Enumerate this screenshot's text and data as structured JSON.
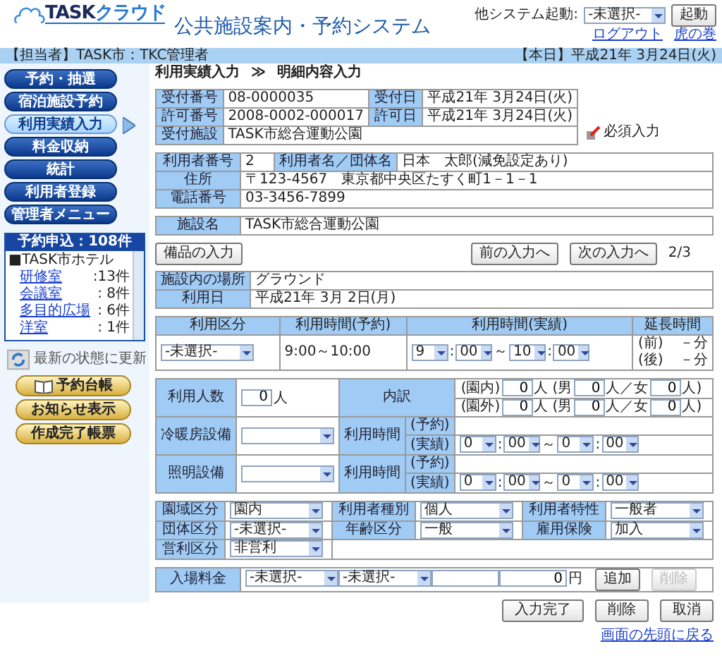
{
  "header": {
    "logo": {
      "brand": "TASK",
      "suffix": "クラウド"
    },
    "title": "公共施設案内・予約システム",
    "launcher_label": "他システム起動:",
    "launcher_select": "-未選択-",
    "launch_button": "起動",
    "links": [
      "ログアウト",
      "虎の巻"
    ]
  },
  "info_bar": {
    "user": "【担当者】TASK市：TKC管理者",
    "today": "【本日】平成21年 3月24日(火)"
  },
  "menu": [
    {
      "label": "予約・抽選",
      "selected": false
    },
    {
      "label": "宿泊施設予約",
      "selected": false
    },
    {
      "label": "利用実績入力",
      "selected": true
    },
    {
      "label": "料金収納",
      "selected": false
    },
    {
      "label": "統計",
      "selected": false
    },
    {
      "label": "利用者登録",
      "selected": false
    },
    {
      "label": "管理者メニュー",
      "selected": false
    }
  ],
  "requests": {
    "title": "予約申込：108件",
    "group": "■TASK市ホテル",
    "items": [
      {
        "name": "研修室",
        "count": ":13件"
      },
      {
        "name": "会議室",
        "count": ": 8件"
      },
      {
        "name": "多目的広場",
        "count": ": 6件"
      },
      {
        "name": "洋室",
        "count": ": 1件"
      }
    ]
  },
  "refresh_button": "最新の状態に更新",
  "side_buttons": [
    {
      "label": "予約台帳",
      "kind": "book"
    },
    {
      "label": "お知らせ表示",
      "kind": "plain"
    },
    {
      "label": "作成完了帳票",
      "kind": "plain"
    }
  ],
  "breadcrumb": {
    "parent": "利用実績入力",
    "separator": "≫",
    "current": "明細内容入力"
  },
  "receipt": [
    [
      {
        "label": "受付番号",
        "value": "08-0000035"
      },
      {
        "label": "受付日",
        "value": "平成21年 3月24日(火)"
      }
    ],
    [
      {
        "label": "許可番号",
        "value": "2008-0002-000017"
      },
      {
        "label": "許可日",
        "value": "平成21年 3月24日(火)"
      }
    ],
    [
      {
        "label": "受付施設",
        "value": "TASK市総合運動公園"
      }
    ]
  ],
  "required_note": "必須入力",
  "user_info": [
    [
      {
        "label": "利用者番号",
        "value": "2"
      },
      {
        "label": "利用者名／団体名",
        "value": "日本　太郎(減免設定あり)"
      }
    ],
    [
      {
        "label": "住所",
        "value": "〒123-4567　東京都中央区たすく町1－1－1"
      }
    ],
    [
      {
        "label": "電話番号",
        "value": "03-3456-7899"
      }
    ]
  ],
  "facility": [
    [
      {
        "label": "施設名",
        "value": "TASK市総合運動公園"
      }
    ]
  ],
  "nav": {
    "equipment_button": "備品の入力",
    "prev_button": "前の入力へ",
    "next_button": "次の入力へ",
    "page": "2/3"
  },
  "place": [
    [
      {
        "label": "施設内の場所",
        "value": "グラウンド"
      }
    ],
    [
      {
        "label": "利用日",
        "value": "平成21年 3月 2日(月)"
      }
    ]
  ],
  "usage": {
    "headers": [
      "利用区分",
      "利用時間(予約)",
      "利用時間(実績)",
      "延長時間"
    ],
    "category": "-未選択-",
    "reserved_time": "9:00～10:00",
    "actual_time": [
      {
        "kind": "time",
        "value": "9"
      },
      {
        "kind": "text",
        "text": ":"
      },
      {
        "kind": "time",
        "value": "00"
      },
      {
        "kind": "text",
        "text": "～"
      },
      {
        "kind": "time",
        "value": "10"
      },
      {
        "kind": "text",
        "text": ":"
      },
      {
        "kind": "time",
        "value": "00"
      }
    ],
    "extension": [
      {
        "label": "(前)",
        "value": "－分"
      },
      {
        "label": "(後)",
        "value": "－分"
      }
    ]
  },
  "attendance": {
    "label": "利用人数",
    "count": "0",
    "unit": "人",
    "breakdown_label": "内訳",
    "breakdown": [
      [
        {
          "kind": "text",
          "text": "(園内)"
        },
        {
          "kind": "input",
          "value": "0"
        },
        {
          "kind": "text",
          "text": "人 (男"
        },
        {
          "kind": "input",
          "value": "0"
        },
        {
          "kind": "text",
          "text": "人／女"
        },
        {
          "kind": "input",
          "value": "0"
        },
        {
          "kind": "text",
          "text": "人)"
        }
      ],
      [
        {
          "kind": "text",
          "text": "(園外)"
        },
        {
          "kind": "input",
          "value": "0"
        },
        {
          "kind": "text",
          "text": "人 (男"
        },
        {
          "kind": "input",
          "value": "0"
        },
        {
          "kind": "text",
          "text": "人／女"
        },
        {
          "kind": "input",
          "value": "0"
        },
        {
          "kind": "text",
          "text": "人)"
        }
      ]
    ]
  },
  "equipment": [
    {
      "label": "冷暖房設備",
      "time_label": "利用時間",
      "reserved_label": "(予約)",
      "actual_label": "(実績)",
      "actual": [
        {
          "kind": "time",
          "value": "0"
        },
        {
          "kind": "text",
          "text": ":"
        },
        {
          "kind": "time",
          "value": "00"
        },
        {
          "kind": "text",
          "text": "～"
        },
        {
          "kind": "time",
          "value": "0"
        },
        {
          "kind": "text",
          "text": ":"
        },
        {
          "kind": "time",
          "value": "00"
        }
      ]
    },
    {
      "label": "照明設備",
      "time_label": "利用時間",
      "reserved_label": "(予約)",
      "actual_label": "(実績)",
      "actual": [
        {
          "kind": "time",
          "value": "0"
        },
        {
          "kind": "text",
          "text": ":"
        },
        {
          "kind": "time",
          "value": "00"
        },
        {
          "kind": "text",
          "text": "～"
        },
        {
          "kind": "time",
          "value": "0"
        },
        {
          "kind": "text",
          "text": ":"
        },
        {
          "kind": "time",
          "value": "00"
        }
      ]
    }
  ],
  "classification": [
    [
      {
        "label": "園域区分",
        "value": "園内"
      },
      {
        "label": "利用者種別",
        "value": "個人"
      },
      {
        "label": "利用者特性",
        "value": "一般者"
      }
    ],
    [
      {
        "label": "団体区分",
        "value": "-未選択-"
      },
      {
        "label": "年齢区分",
        "value": "一般"
      },
      {
        "label": "雇用保険",
        "value": "加入"
      }
    ],
    [
      {
        "label": "営利区分",
        "value": "非営利"
      }
    ]
  ],
  "admission": {
    "label": "入場料金",
    "parts": [
      {
        "kind": "select",
        "value": "-未選択-"
      },
      {
        "kind": "select",
        "value": "-未選択-"
      },
      {
        "kind": "input"
      },
      {
        "kind": "input",
        "value": "0"
      },
      {
        "kind": "text",
        "text": "円"
      },
      {
        "kind": "button",
        "text": "追加",
        "disabled": false
      },
      {
        "kind": "button",
        "text": "削除",
        "disabled": true
      }
    ]
  },
  "footer_buttons": [
    "入力完了",
    "削除",
    "取消"
  ],
  "top_link": "画面の先頭に戻る"
}
